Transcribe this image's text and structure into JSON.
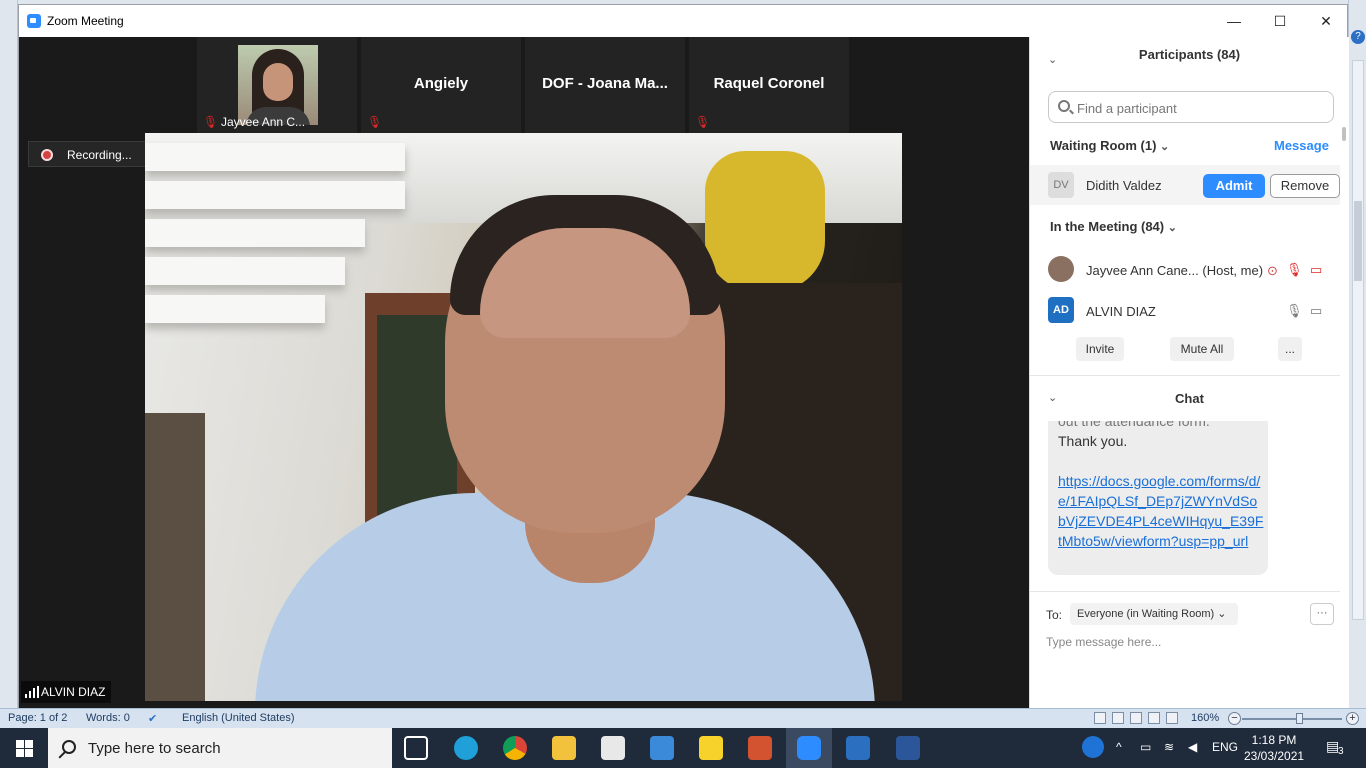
{
  "window": {
    "title": "Zoom Meeting",
    "minimize": "—",
    "maximize": "☐",
    "close": "✕"
  },
  "thumbnails": [
    {
      "label": "Jayvee Ann C...",
      "kind": "photo"
    },
    {
      "label": "Angiely",
      "kind": "name"
    },
    {
      "label": "DOF - Joana Ma...",
      "kind": "name"
    },
    {
      "label": "Raquel Coronel",
      "kind": "name"
    }
  ],
  "recording_label": "Recording...",
  "speaker_name": "ALVIN DIAZ",
  "participants": {
    "header": "Participants (84)",
    "search_placeholder": "Find a participant",
    "waiting_room_title": "Waiting Room (1)",
    "message_link": "Message",
    "waiting": {
      "initials": "DV",
      "name": "Didith Valdez",
      "admit": "Admit",
      "remove": "Remove"
    },
    "in_meeting_title": "In the Meeting (84)",
    "members": [
      {
        "name": "Jayvee Ann Cane...",
        "role": "(Host, me)"
      },
      {
        "initials": "AD",
        "name": "ALVIN DIAZ"
      }
    ],
    "invite": "Invite",
    "mute_all": "Mute All",
    "more": "..."
  },
  "chat": {
    "header": "Chat",
    "partial_line": "out the attendance form.",
    "thanks": "Thank you.",
    "link": "https://docs.google.com/forms/d/e/1FAIpQLSf_DEp7jZWYnVdSobVjZEVDE4PL4ceWIHqyu_E39FtMbto5w/viewform?usp=pp_url",
    "to_label": "To:",
    "recipient": "Everyone (in Waiting Room) ⌄",
    "more": "···",
    "placeholder": "Type message here..."
  },
  "word_status": {
    "page": "Page: 1 of 2",
    "words": "Words: 0",
    "language": "English (United States)",
    "zoom": "160%"
  },
  "taskbar": {
    "search": "Type here to search",
    "lang": "ENG",
    "time": "1:18 PM",
    "date": "23/03/2021",
    "notifications": "3"
  },
  "colors": {
    "zoom_blue": "#2d8cff",
    "muted_red": "#e02828"
  }
}
